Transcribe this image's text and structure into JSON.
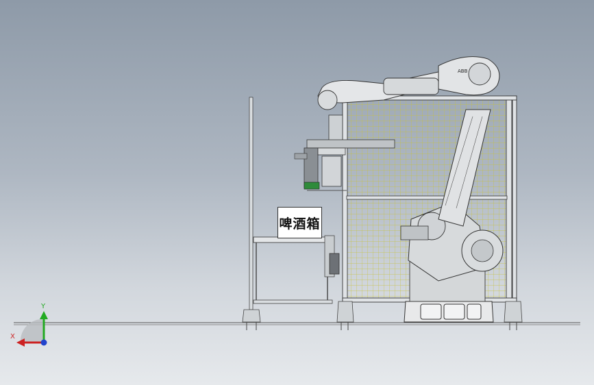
{
  "viewport": {
    "background_top": "#8e9aa8",
    "background_bottom": "#e6e9ec"
  },
  "part_label": "啤酒箱",
  "robot_brand": "ABB",
  "triad": {
    "x_label": "X",
    "y_label": "Y",
    "x_color": "#cc2222",
    "y_color": "#22aa22",
    "z_color": "#2244cc"
  }
}
